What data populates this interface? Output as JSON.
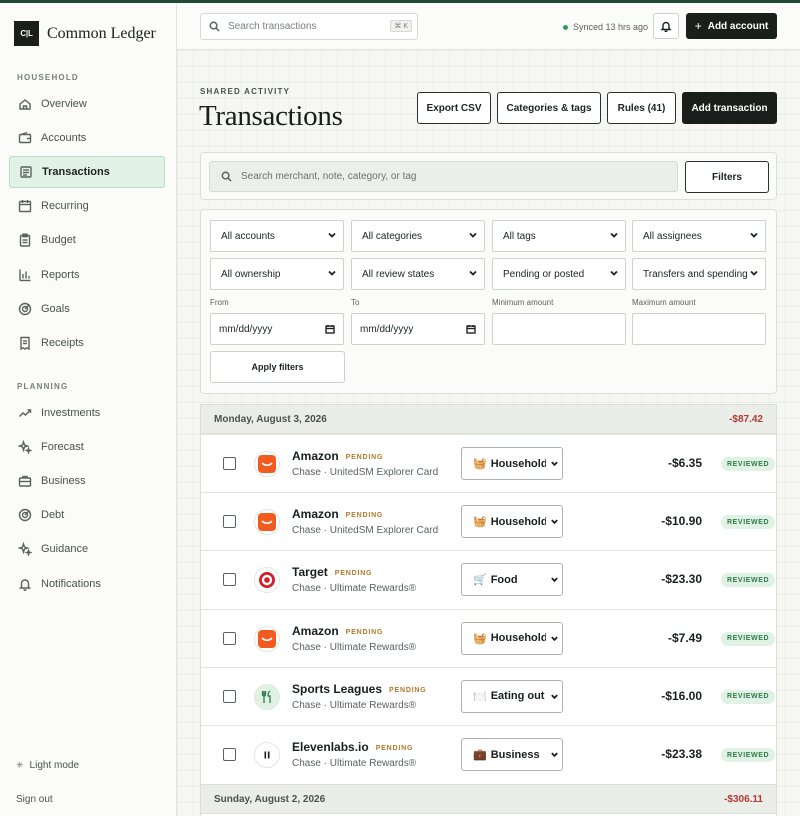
{
  "app": {
    "name": "Common Ledger",
    "logo_mark": "C|L"
  },
  "sidebar": {
    "household_label": "HOUSEHOLD",
    "household_items": [
      {
        "label": "Overview",
        "icon": "home-icon"
      },
      {
        "label": "Accounts",
        "icon": "wallet-icon"
      },
      {
        "label": "Transactions",
        "icon": "list-icon",
        "active": true
      },
      {
        "label": "Recurring",
        "icon": "calendar-icon"
      },
      {
        "label": "Budget",
        "icon": "clipboard-icon"
      },
      {
        "label": "Reports",
        "icon": "bar-chart-icon"
      },
      {
        "label": "Goals",
        "icon": "target-icon"
      },
      {
        "label": "Receipts",
        "icon": "receipt-icon"
      }
    ],
    "planning_label": "PLANNING",
    "planning_items": [
      {
        "label": "Investments",
        "icon": "trend-up-icon"
      },
      {
        "label": "Forecast",
        "icon": "sparkle-icon"
      },
      {
        "label": "Business",
        "icon": "briefcase-icon"
      },
      {
        "label": "Debt",
        "icon": "target-icon"
      },
      {
        "label": "Guidance",
        "icon": "sparkle-icon"
      },
      {
        "label": "Notifications",
        "icon": "bell-icon"
      }
    ],
    "light_mode": "Light mode",
    "sign_out": "Sign out"
  },
  "topbar": {
    "search_placeholder": "Search transactions",
    "shortcut": "⌘ K",
    "sync_status": "Synced 13 hrs ago",
    "add_account": "Add account"
  },
  "header": {
    "eyebrow": "SHARED ACTIVITY",
    "title": "Transactions",
    "buttons": [
      "Export CSV",
      "Categories & tags",
      "Rules (41)",
      "Add transaction"
    ]
  },
  "search": {
    "placeholder": "Search merchant, note, category, or tag",
    "filters_label": "Filters"
  },
  "filters": {
    "selects_row1": [
      "All accounts",
      "All categories",
      "All tags",
      "All assignees"
    ],
    "selects_row2": [
      "All ownership",
      "All review states",
      "Pending or posted",
      "Transfers and spending"
    ],
    "labels": [
      "From",
      "To",
      "Minimum amount",
      "Maximum amount"
    ],
    "from_value": "mm/dd/yyyy",
    "to_value": "mm/dd/yyyy",
    "min_value": "",
    "max_value": "",
    "apply_label": "Apply filters"
  },
  "groups": [
    {
      "date": "Monday, August 3, 2026",
      "total": "-$87.42",
      "transactions": [
        {
          "merchant": "Amazon",
          "status": "PENDING",
          "account": "Chase · UnitedSM Explorer Card",
          "category_emoji": "🧺",
          "category": "Household",
          "amount": "-$6.35",
          "review": "REVIEWED",
          "logo": "amazon"
        },
        {
          "merchant": "Amazon",
          "status": "PENDING",
          "account": "Chase · UnitedSM Explorer Card",
          "category_emoji": "🧺",
          "category": "Household",
          "amount": "-$10.90",
          "review": "REVIEWED",
          "logo": "amazon"
        },
        {
          "merchant": "Target",
          "status": "PENDING",
          "account": "Chase · Ultimate Rewards®",
          "category_emoji": "🛒",
          "category": "Food",
          "amount": "-$23.30",
          "review": "REVIEWED",
          "logo": "target"
        },
        {
          "merchant": "Amazon",
          "status": "PENDING",
          "account": "Chase · Ultimate Rewards®",
          "category_emoji": "🧺",
          "category": "Household",
          "amount": "-$7.49",
          "review": "REVIEWED",
          "logo": "amazon"
        },
        {
          "merchant": "Sports Leagues",
          "status": "PENDING",
          "account": "Chase · Ultimate Rewards®",
          "category_emoji": "🍽️",
          "category": "Eating out",
          "amount": "-$16.00",
          "review": "REVIEWED",
          "logo": "fork"
        },
        {
          "merchant": "Elevenlabs.io",
          "status": "PENDING",
          "account": "Chase · Ultimate Rewards®",
          "category_emoji": "💼",
          "category": "Business",
          "amount": "-$23.38",
          "review": "REVIEWED",
          "logo": "eleven"
        }
      ]
    },
    {
      "date": "Sunday, August 2, 2026",
      "total": "-$306.11",
      "transactions": []
    }
  ],
  "colors": {
    "accent": "#1a1f1c",
    "brand_green": "#1f4a33",
    "negative": "#b23a32",
    "reviewed": "#2e7a4a",
    "pending": "#b07a2a"
  }
}
